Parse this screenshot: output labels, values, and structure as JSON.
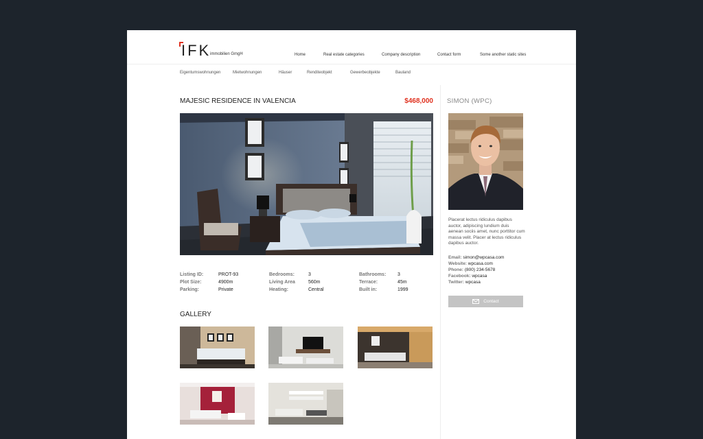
{
  "brand": {
    "logo": "IFK",
    "sub": "immobilien GmgH"
  },
  "main_nav": [
    "Home",
    "Real estate categories",
    "Company description",
    "Contact form",
    "Some another static sites"
  ],
  "sub_nav": [
    "Eigentumswohnungen",
    "Mietwohnungen",
    "Häuser",
    "Renditeobjekt",
    "Gewerbeobjekte",
    "Bauland"
  ],
  "listing": {
    "title": "MAJESIC RESIDENCE IN VALENCIA",
    "price": "$468,000",
    "details": [
      {
        "label": "Listing ID:",
        "value": "PROT-93"
      },
      {
        "label": "Plot Size:",
        "value": "4900m"
      },
      {
        "label": "Parking:",
        "value": "Private"
      },
      {
        "label": "Bedrooms:",
        "value": "3"
      },
      {
        "label": "Living Area",
        "value": "560m"
      },
      {
        "label": "Heating:",
        "value": "Central"
      },
      {
        "label": "Bathrooms:",
        "value": "3"
      },
      {
        "label": "Terrace:",
        "value": "45m"
      },
      {
        "label": "Built in:",
        "value": "1999"
      }
    ]
  },
  "gallery": {
    "title": "GALLERY"
  },
  "agent": {
    "name": "SIMON (WPC)",
    "bio": "Placerat lectus ridiculus dapibus auctor, adipiscing lundium duis aenean sociis amet, nunc porttitor cum massa velit. Placer at lectus ridiculus dapibus auctor.",
    "contacts": [
      {
        "label": "Email:",
        "value": "simon@wpcasa.com"
      },
      {
        "label": "Website:",
        "value": "wpcasa.com"
      },
      {
        "label": "Phone:",
        "value": "(800) 234-5678"
      },
      {
        "label": "Facebook:",
        "value": "wpcasa"
      },
      {
        "label": "Twitter:",
        "value": "wpcasa"
      }
    ],
    "contact_button": "Contact"
  },
  "colors": {
    "accent": "#e0311f",
    "background": "#1d242c",
    "button": "#c4c4c4"
  }
}
